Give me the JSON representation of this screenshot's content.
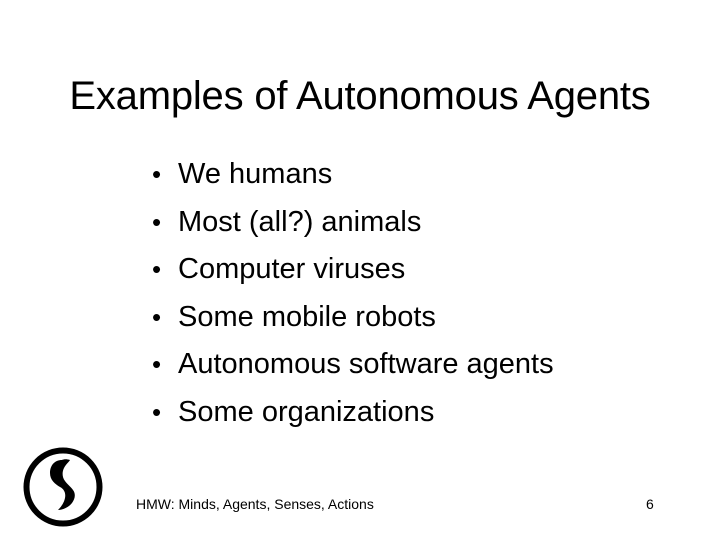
{
  "slide": {
    "title": "Examples of Autonomous Agents",
    "bullets": [
      "We humans",
      "Most (all?) animals",
      "Computer viruses",
      "Some mobile robots",
      "Autonomous software agents",
      "Some organizations"
    ],
    "bullet_glyph": "•",
    "footer": "HMW: Minds, Agents, Senses, Actions",
    "page_number": "6"
  },
  "icons": {
    "logo": "circle-emblem-logo"
  },
  "colors": {
    "background": "#ffffff",
    "text": "#000000"
  }
}
